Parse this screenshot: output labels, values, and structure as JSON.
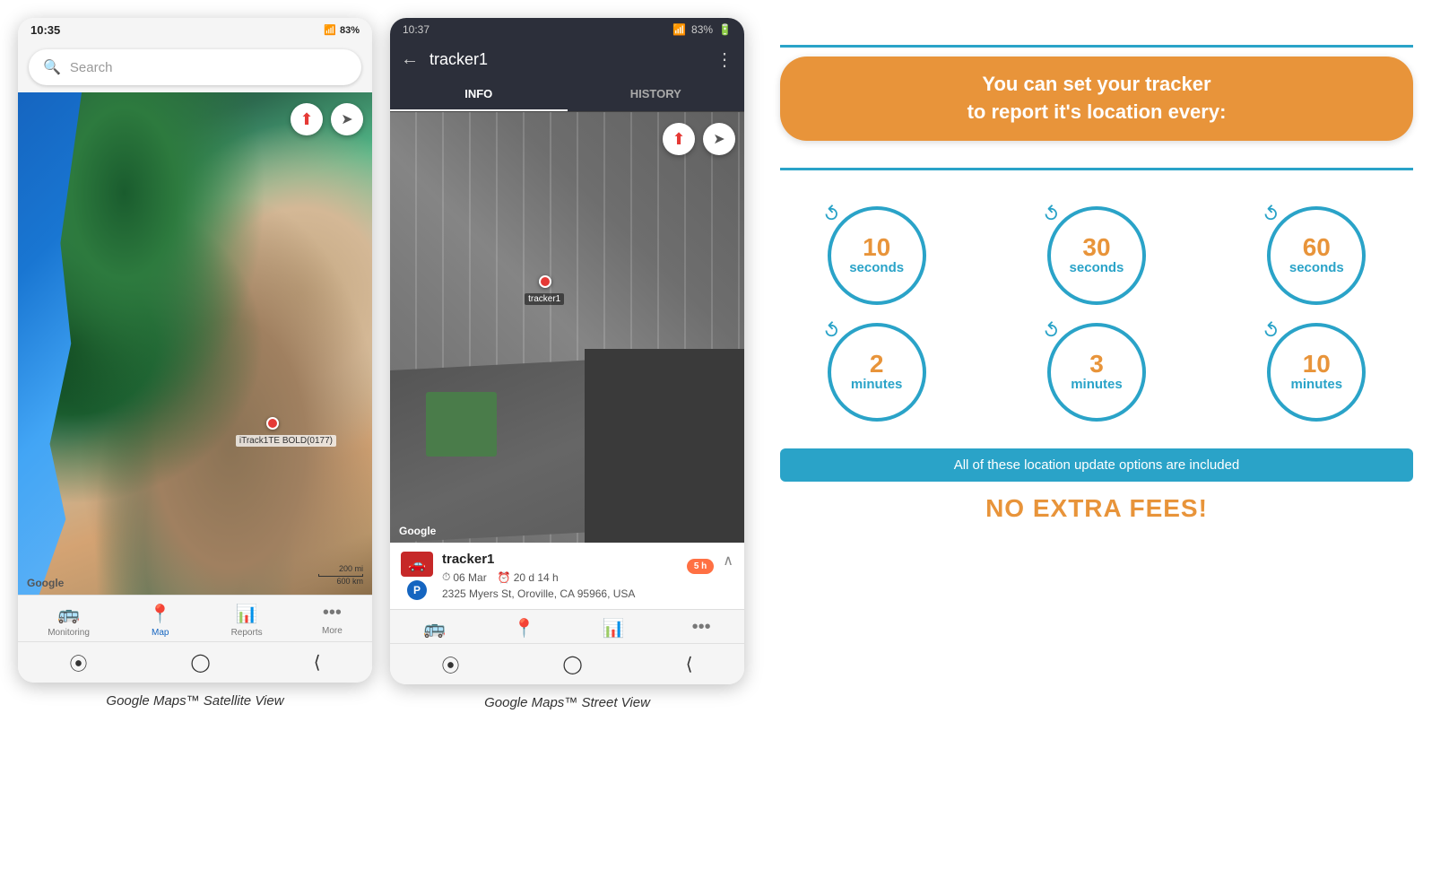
{
  "phone1": {
    "status_bar": {
      "time": "10:35",
      "battery": "83%",
      "signal": "●●● ▲"
    },
    "search": {
      "placeholder": "Search"
    },
    "map": {
      "tracker_label": "iTrack1TE BOLD(0177)",
      "google_logo": "Google",
      "scale_200mi": "200 mi",
      "scale_600km": "600 km"
    },
    "nav": {
      "monitoring": "Monitoring",
      "map": "Map",
      "reports": "Reports",
      "more": "More"
    },
    "caption": "Google Maps™ Satellite View"
  },
  "phone2": {
    "status_bar": {
      "time": "10:37",
      "battery": "83%"
    },
    "header": {
      "title": "tracker1",
      "back": "←",
      "menu": "⋮"
    },
    "tabs": {
      "info": "INFO",
      "history": "HISTORY"
    },
    "map": {
      "tracker_label": "tracker1",
      "google_logo": "Google"
    },
    "info_panel": {
      "tracker_name": "tracker1",
      "date": "06 Mar",
      "duration": "20 d 14 h",
      "address": "2325 Myers St, Oroville, CA 95966, USA",
      "badge": "5 h"
    },
    "caption": "Google Maps™ Street View"
  },
  "infographic": {
    "title_line1": "You can set your tracker",
    "title_line2": "to report it's location every:",
    "circles": [
      {
        "number": "10",
        "unit": "seconds"
      },
      {
        "number": "30",
        "unit": "seconds"
      },
      {
        "number": "60",
        "unit": "seconds"
      },
      {
        "number": "2",
        "unit": "minutes"
      },
      {
        "number": "3",
        "unit": "minutes"
      },
      {
        "number": "10",
        "unit": "minutes"
      }
    ],
    "banner_text": "All of these location update options are included",
    "no_fees": "NO EXTRA FEES!",
    "colors": {
      "orange": "#e8943a",
      "teal": "#2aa3c8"
    }
  }
}
